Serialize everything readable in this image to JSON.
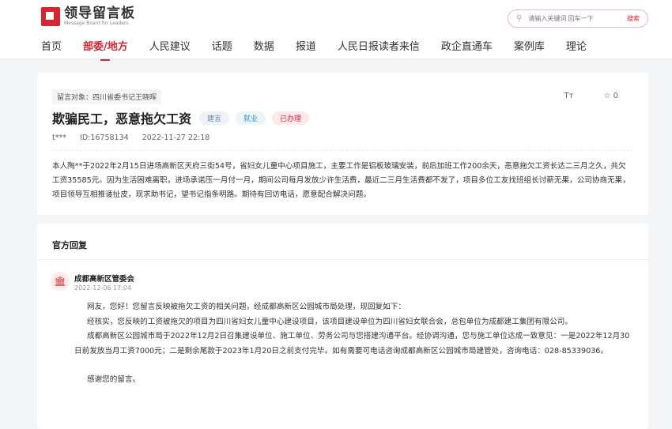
{
  "header": {
    "logo_title": "领导留言板",
    "logo_sub": "Message Board for Leaders",
    "search_placeholder": "请输入关键词 回车一下",
    "search_button": "搜索"
  },
  "nav": [
    "首页",
    "部委/地方",
    "人民建议",
    "话题",
    "数据",
    "报道",
    "人民日报读者来信",
    "政企直通车",
    "案例库",
    "理论"
  ],
  "message": {
    "target": "留言对象：四川省委书记王晓晖",
    "title": "欺骗民工，恶意拖欠工资",
    "tags": [
      "建言",
      "就业",
      "已办理"
    ],
    "font_tool": "Tт",
    "favorites": "0",
    "author": "t***",
    "id": "ID:16758134",
    "date": "2022-11-27 22:18",
    "content": "本人陶**于2022年2月15日进场高新区天府三街54号，省妇女儿童中心项目施工，主要工作是铝板玻璃安装，前后加班工作200余天，恶意拖欠工资长达二三月之久，共欠工资35585元。因为生活困难离职，进场承诺压一月付一月，期间公司每月发放少许生活费，最近二三月生活费都不发了，项目多位工友找班组长讨薪无果，公司协商无果，项目领导互相推诿扯皮，现求助书记，望书记指条明路。期待有回访电话，愿意配合解决问题。"
  },
  "reply": {
    "section_title": "官方回复",
    "org": "成都高新区管委会",
    "date": "2022-12-06 17:04",
    "paragraphs": [
      "网友，您好！您留言反映被拖欠工资的相关问题，经成都高新区公园城市局处理，现回复如下：",
      "经核实，您反映的工资被拖欠的项目为四川省妇女儿童中心建设项目，该项目建设单位为四川省妇女联合会，总包单位为成都建工集团有限公司。",
      "成都高新区公园城市局于2022年12月2日召集建设单位、施工单位、劳务公司与您搭建沟通平台。经协调沟通，您与施工单位达成一致意见：一是2022年12月30日前发放当月工资7000元；二是剩余尾款于2023年1月20日之前支付完毕。如有需要可电话咨询成都高新区公园城市局建管处，咨询电话：028-85339036。",
      "感谢您的留言。"
    ]
  }
}
